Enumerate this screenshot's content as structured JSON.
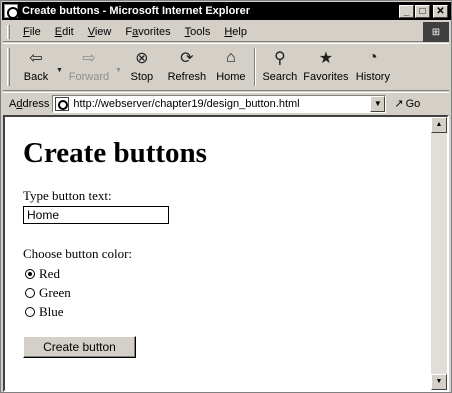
{
  "window": {
    "title": "Create buttons - Microsoft Internet Explorer",
    "min_glyph": "_",
    "max_glyph": "□",
    "close_glyph": "✕"
  },
  "menu": {
    "items": [
      {
        "accel": "F",
        "rest": "ile"
      },
      {
        "accel": "E",
        "rest": "dit"
      },
      {
        "accel": "V",
        "rest": "iew"
      },
      {
        "pre": "F",
        "accel": "a",
        "rest": "vorites"
      },
      {
        "accel": "T",
        "rest": "ools"
      },
      {
        "accel": "H",
        "rest": "elp"
      }
    ]
  },
  "toolbar": {
    "back": {
      "label": "Back",
      "icon": "back-arrow-icon",
      "glyph": "⇦"
    },
    "forward": {
      "label": "Forward",
      "icon": "forward-arrow-icon",
      "glyph": "⇨"
    },
    "stop": {
      "label": "Stop",
      "icon": "stop-icon",
      "glyph": "⊗"
    },
    "refresh": {
      "label": "Refresh",
      "icon": "refresh-icon",
      "glyph": "⟳"
    },
    "home": {
      "label": "Home",
      "icon": "home-icon",
      "glyph": "⌂"
    },
    "search": {
      "label": "Search",
      "icon": "search-icon",
      "glyph": "⚲"
    },
    "favorites": {
      "label": "Favorites",
      "icon": "favorites-icon",
      "glyph": "★"
    },
    "history": {
      "label": "History",
      "icon": "history-icon",
      "glyph": "◔"
    }
  },
  "address": {
    "label_accel": "d",
    "label_pre": "A",
    "label_rest": "dress",
    "url": "http://webserver/chapter19/design_button.html",
    "go_label": "Go",
    "go_glyph": "↗"
  },
  "page": {
    "heading": "Create buttons",
    "text_label": "Type button text:",
    "text_value": "Home",
    "color_label": "Choose button color:",
    "colors": [
      {
        "label": "Red",
        "checked": true
      },
      {
        "label": "Green",
        "checked": false
      },
      {
        "label": "Blue",
        "checked": false
      }
    ],
    "submit_label": "Create button"
  }
}
